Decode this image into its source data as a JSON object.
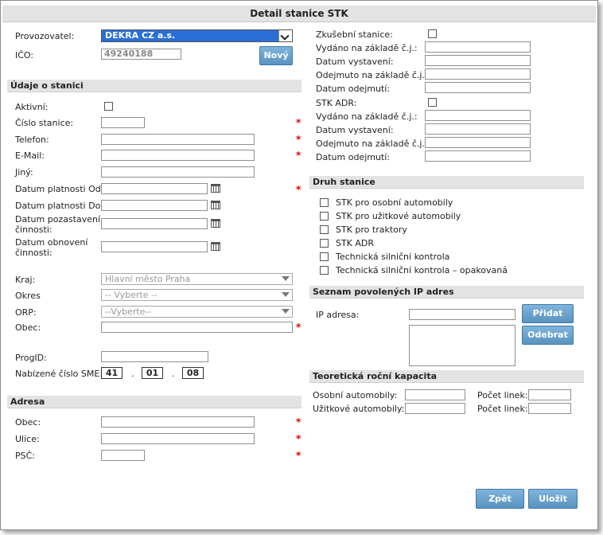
{
  "title": "Detail stanice STK",
  "provozovatel": {
    "label": "Provozovatel:",
    "value": "DEKRA CZ a.s."
  },
  "ico": {
    "label": "IČO:",
    "value": "49240188",
    "button": "Nový"
  },
  "udaje": {
    "heading": "Údaje o stanici",
    "aktivni": "Aktivní:",
    "cislo_stanice": "Číslo stanice:",
    "telefon": "Telefon:",
    "email": "E-Mail:",
    "jiny": "Jiný:",
    "platnost_od": "Datum platnosti Od:",
    "platnost_do": "Datum platnosti Do:",
    "pozastaveni_1": "Datum pozastavení",
    "pozastaveni_2": "činnosti:",
    "obnoveni_1": "Datum obnovení",
    "obnoveni_2": "činnosti:",
    "kraj": {
      "label": "Kraj:",
      "value": "Hlavní město Praha"
    },
    "okres": {
      "label": "Okres",
      "value": "-- Vyberte --"
    },
    "orp": {
      "label": "ORP:",
      "value": "--Vyberte--"
    },
    "obec": "Obec:",
    "progid": "ProgID:",
    "sme": {
      "label": "Nabízené číslo SME:",
      "part1": "41",
      "sep1": ".",
      "part2": "01",
      "sep2": ".",
      "part3": "08"
    }
  },
  "adresa": {
    "heading": "Adresa",
    "obec": "Obec:",
    "ulice": "Ulice:",
    "psc": "PSČ:"
  },
  "zkusebni": {
    "label": "Zkušební stanice:",
    "vydano": "Vydáno na základě č.j.:",
    "vystaveni": "Datum vystavení:",
    "odejmuto": "Odejmuto na základě č.j.:",
    "odejmuti": "Datum odejmutí:"
  },
  "adr": {
    "label": "STK ADR:",
    "vydano": "Vydáno na základě č.j.:",
    "vystaveni": "Datum vystavení:",
    "odejmuto": "Odejmuto na základě č.j.:",
    "odejmuti": "Datum odejmutí:"
  },
  "druh": {
    "heading": "Druh stanice",
    "items": [
      "STK pro osobní automobily",
      "STK pro užitkové automobily",
      "STK pro traktory",
      "STK ADR",
      "Technická silniční kontrola",
      "Technická silniční kontrola – opakovaná"
    ]
  },
  "ip": {
    "heading": "Seznam povolených IP adres",
    "label": "IP adresa:",
    "add": "Přidat",
    "remove": "Odebrat"
  },
  "kapacita": {
    "heading": "Teoretická roční kapacita",
    "osobni": "Osobní automobily:",
    "uzitkove": "Užitkové automobily:",
    "linek1": "Počet linek:",
    "linek2": "Počet linek:"
  },
  "footer": {
    "back": "Zpět",
    "save": "Uložit"
  },
  "icons": {
    "calendar": "calendar-icon",
    "dropdown": "chevron-down-icon",
    "required": "required-star"
  },
  "colors": {
    "required": "#e00000",
    "button": "#6aa3cc",
    "section": "#e3e3e3",
    "selected": "#2a6fd6"
  }
}
